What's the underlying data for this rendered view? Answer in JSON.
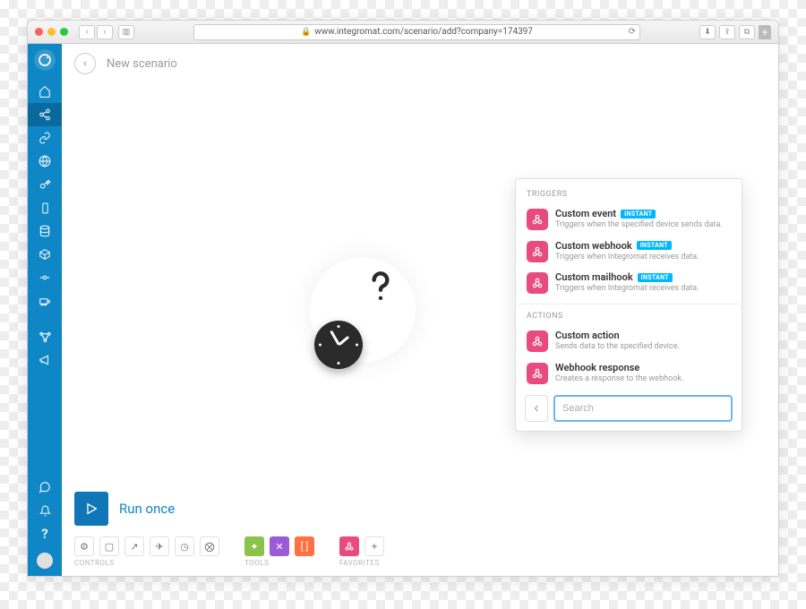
{
  "browser": {
    "url": "www.integromat.com/scenario/add?company=174397"
  },
  "page": {
    "title": "New scenario"
  },
  "sidebar": {
    "items": [
      "home",
      "share",
      "link",
      "globe",
      "key",
      "mobile",
      "database",
      "cube",
      "dash",
      "truck",
      "",
      "flow",
      "megaphone"
    ],
    "bottom": [
      "chat",
      "bell",
      "help"
    ]
  },
  "panel": {
    "triggers_heading": "TRIGGERS",
    "actions_heading": "ACTIONS",
    "instant_badge": "INSTANT",
    "triggers": [
      {
        "title": "Custom event",
        "desc": "Triggers when the specified device sends data.",
        "instant": true
      },
      {
        "title": "Custom webhook",
        "desc": "Triggers when Integromat receives data.",
        "instant": true
      },
      {
        "title": "Custom mailhook",
        "desc": "Triggers when Integromat receives data.",
        "instant": true
      }
    ],
    "actions": [
      {
        "title": "Custom action",
        "desc": "Sends data to the specified device."
      },
      {
        "title": "Webhook response",
        "desc": "Creates a response to the webhook."
      }
    ],
    "search_placeholder": "Search"
  },
  "bottom": {
    "run_label": "Run once",
    "controls_label": "CONTROLS",
    "tools_label": "TOOLS",
    "favorites_label": "FAVORITES"
  }
}
